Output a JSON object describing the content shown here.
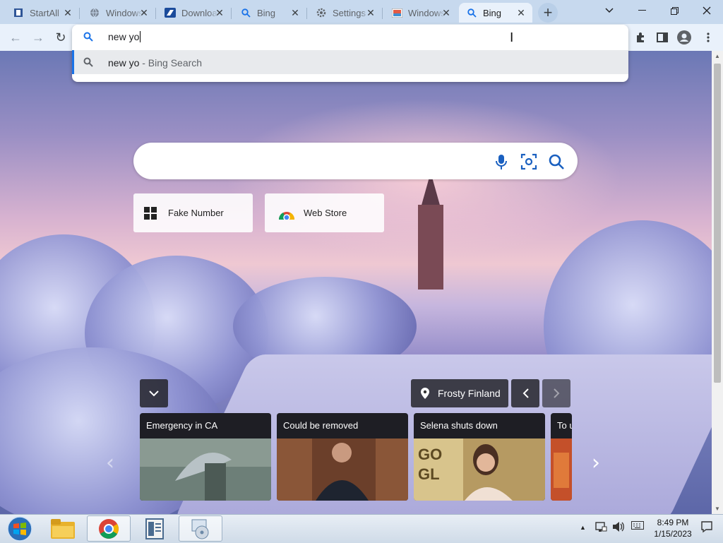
{
  "tabs": [
    {
      "label": "StartAll",
      "icon": "document-icon"
    },
    {
      "label": "Windows",
      "icon": "globe-icon"
    },
    {
      "label": "Downloads",
      "icon": "download-site-icon"
    },
    {
      "label": "Bing",
      "icon": "search-icon"
    },
    {
      "label": "Settings",
      "icon": "gear-icon"
    },
    {
      "label": "Windows",
      "icon": "photo-icon"
    },
    {
      "label": "Bing",
      "icon": "search-icon",
      "active": true
    }
  ],
  "omnibox": {
    "input_value": "new yo",
    "suggestion_query": "new yo",
    "suggestion_suffix": " - Bing Search"
  },
  "bing": {
    "search_placeholder": "",
    "tiles": [
      {
        "label": "Fake Number"
      },
      {
        "label": "Web Store"
      }
    ],
    "location_label": "Frosty Finland",
    "news_cards": [
      {
        "title": "Emergency in CA"
      },
      {
        "title": "Could be removed"
      },
      {
        "title": "Selena shuts down"
      },
      {
        "title": "To u"
      }
    ]
  },
  "taskbar": {
    "time": "8:49 PM",
    "date": "1/15/2023"
  },
  "colors": {
    "tabstrip": "#c7d9ee",
    "toolbar": "#e9f1fb",
    "accent": "#1a73e8"
  }
}
